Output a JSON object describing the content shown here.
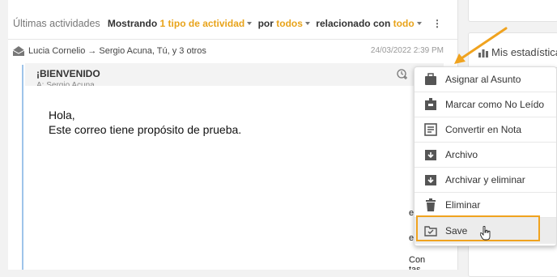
{
  "colors": {
    "accent": "#e8a31a",
    "highlight": "#f0a31f",
    "thread_line": "#9ec4ea"
  },
  "header": {
    "title": "Últimas actividades",
    "filter": {
      "prefix": "Mostrando",
      "activity": "1 tipo de actividad",
      "por": "por",
      "por_value": "todos",
      "related": "relacionado con",
      "related_value": "todo"
    }
  },
  "activity": {
    "icon": "envelope-open-icon",
    "participants": "Lucia Cornelio → Sergio Acuna, Tú, y 3 otros",
    "timestamp": "24/03/2022 2:39 PM"
  },
  "email": {
    "subject": "¡BIENVENIDO",
    "to": "A: Sergio Acuna",
    "body_line1": "Hola,",
    "body_line2": "Este correo tiene propósito de prueba.",
    "edge1": "e",
    "edge2": "e",
    "edge3": "Con",
    "edge4": "tas"
  },
  "stats": {
    "label": "Mis estadísticas",
    "icon": "bar-chart-icon"
  },
  "menu": {
    "items": [
      {
        "label": "Asignar al Asunto",
        "icon": "briefcase-icon"
      },
      {
        "label": "Marcar como No Leído",
        "icon": "mark-unread-icon"
      },
      {
        "label": "Convertir en Nota",
        "icon": "note-icon"
      },
      {
        "label": "Archivo",
        "icon": "archive-icon"
      },
      {
        "label": "Archivar y eliminar",
        "icon": "archive-delete-icon"
      },
      {
        "label": "Eliminar",
        "icon": "trash-icon"
      },
      {
        "label": "Save",
        "icon": "folder-check-icon"
      }
    ]
  }
}
